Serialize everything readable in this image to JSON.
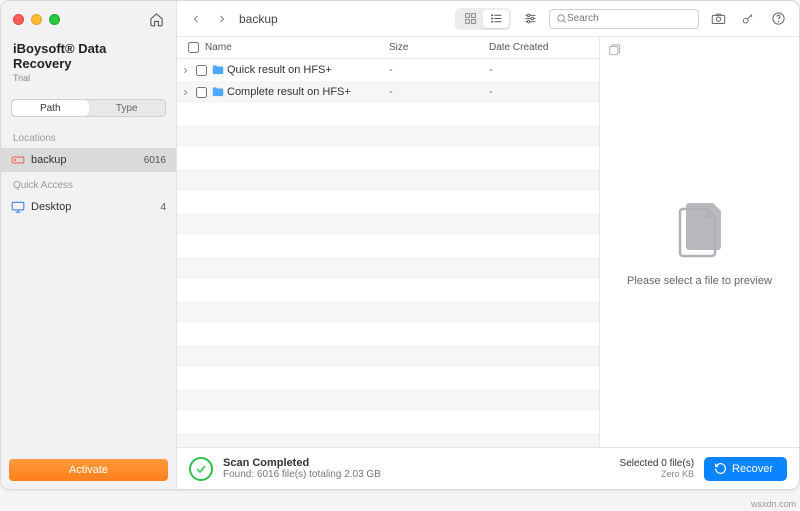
{
  "brand": {
    "title": "iBoysoft® Data Recovery",
    "subtitle": "Trial"
  },
  "sidebar": {
    "tabs": {
      "path": "Path",
      "type": "Type"
    },
    "locations_label": "Locations",
    "locations": [
      {
        "label": "backup",
        "count": "6016"
      }
    ],
    "quick_label": "Quick Access",
    "quick": [
      {
        "label": "Desktop",
        "count": "4"
      }
    ],
    "activate": "Activate"
  },
  "toolbar": {
    "breadcrumb": "backup",
    "search_placeholder": "Search"
  },
  "columns": {
    "name": "Name",
    "size": "Size",
    "date": "Date Created"
  },
  "rows": [
    {
      "name": "Quick result on HFS+",
      "size": "-",
      "date": "-"
    },
    {
      "name": "Complete result on HFS+",
      "size": "-",
      "date": "-"
    }
  ],
  "preview": {
    "message": "Please select a file to preview"
  },
  "status": {
    "title": "Scan Completed",
    "detail": "Found: 6016 file(s) totaling 2.03 GB",
    "selected": "Selected 0 file(s)",
    "selected_size": "Zero KB",
    "recover": "Recover"
  },
  "watermark": "wsxdn.com"
}
